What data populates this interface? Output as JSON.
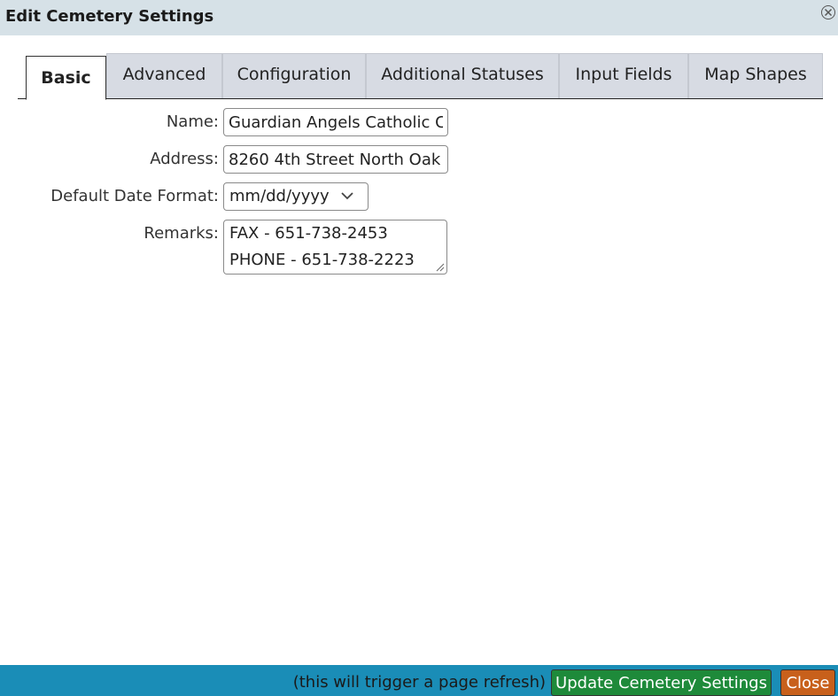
{
  "dialog": {
    "title": "Edit Cemetery Settings"
  },
  "tabs": [
    {
      "label": "Basic",
      "active": true
    },
    {
      "label": "Advanced",
      "active": false
    },
    {
      "label": "Configuration",
      "active": false
    },
    {
      "label": "Additional Statuses",
      "active": false
    },
    {
      "label": "Input Fields",
      "active": false
    },
    {
      "label": "Map Shapes",
      "active": false
    }
  ],
  "form": {
    "name_label": "Name:",
    "name_value": "Guardian Angels Catholic C",
    "address_label": "Address:",
    "address_value": "8260 4th Street North Oak",
    "date_format_label": "Default Date Format:",
    "date_format_value": "mm/dd/yyyy",
    "remarks_label": "Remarks:",
    "remarks_lines": [
      "FAX - 651-738-2453",
      "PHONE - 651-738-2223"
    ]
  },
  "footer": {
    "note": "(this will trigger a page refresh)",
    "update_label": "Update Cemetery Settings",
    "close_label": "Close"
  },
  "colors": {
    "titlebar": "#d6e1e7",
    "footer": "#1a8db7",
    "update_button": "#1e8a3a",
    "close_button": "#c8601b",
    "tab_inactive": "#d7dbe3"
  },
  "icons": {
    "dialog_close": "close-circle-icon",
    "select_arrow": "chevron-down-icon",
    "resize": "resize-grip-icon"
  }
}
